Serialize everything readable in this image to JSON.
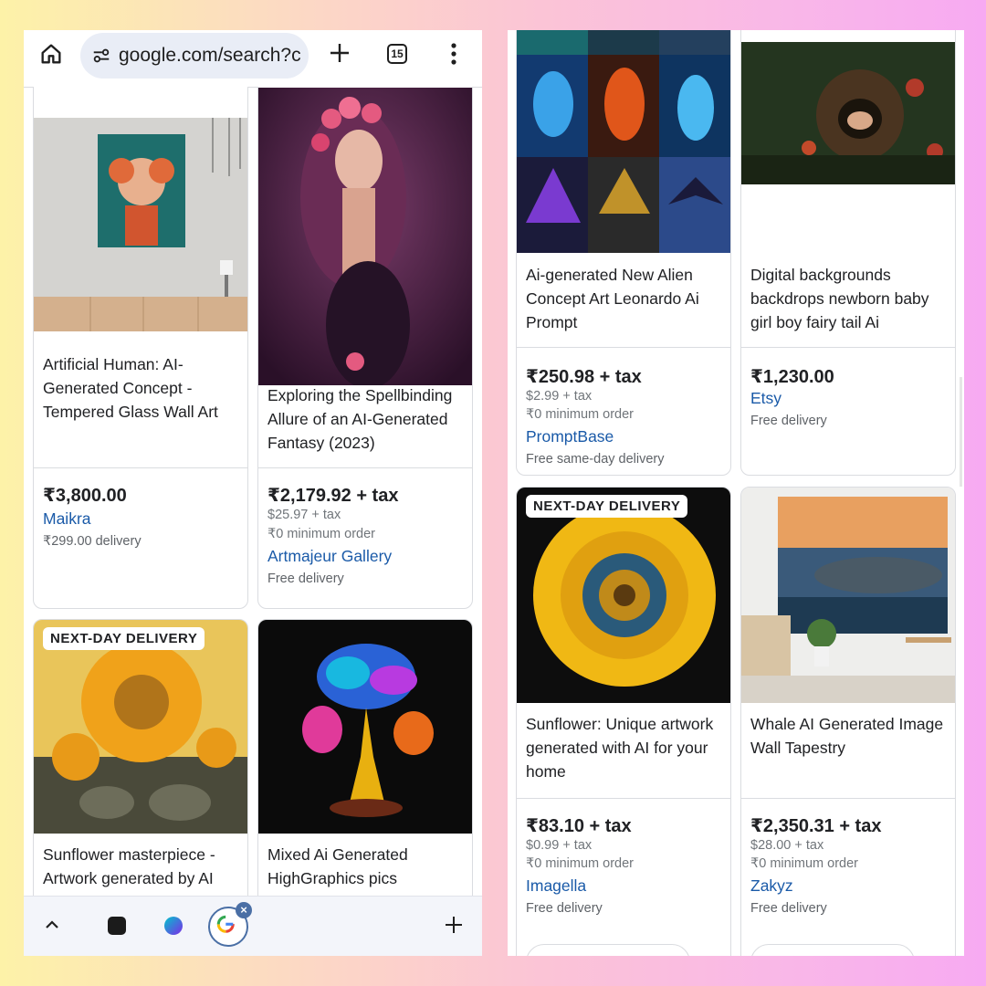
{
  "browser": {
    "url": "google.com/search?c",
    "tab_count": "15"
  },
  "left_panel": {
    "products": [
      {
        "title": "Artificial Human: AI-Generated Concept - Tempered Glass Wall Art",
        "price": "₹3,800.00",
        "merchant": "Maikra",
        "delivery": "₹299.00 delivery"
      },
      {
        "title": "Exploring the Spellbinding Allure of an AI-Generated Fantasy (2023)",
        "price": "₹2,179.92 + tax",
        "tax": "$25.97 + tax",
        "min_order": "₹0 minimum order",
        "merchant": "Artmajeur Gallery",
        "delivery": "Free delivery"
      },
      {
        "badge": "NEXT-DAY DELIVERY",
        "title": "Sunflower masterpiece - Artwork generated by AI"
      },
      {
        "title": "Mixed Ai Generated HighGraphics pics"
      }
    ]
  },
  "right_panel": {
    "products": [
      {
        "title": "Ai-generated New Alien Concept Art Leonardo Ai Prompt",
        "price": "₹250.98 + tax",
        "tax": "$2.99 + tax",
        "min_order": "₹0 minimum order",
        "merchant": "PromptBase",
        "delivery": "Free same-day delivery"
      },
      {
        "title": "Digital backgrounds backdrops newborn baby girl boy fairy tail Ai",
        "price": "₹1,230.00",
        "merchant": "Etsy",
        "delivery": "Free delivery"
      },
      {
        "badge": "NEXT-DAY DELIVERY",
        "title": "Sunflower: Unique artwork generated with AI for your home",
        "price": "₹83.10 + tax",
        "tax": "$0.99 + tax",
        "min_order": "₹0 minimum order",
        "merchant": "Imagella",
        "delivery": "Free delivery"
      },
      {
        "title": "Whale AI Generated Image Wall Tapestry",
        "price": "₹2,350.31 + tax",
        "tax": "$28.00 + tax",
        "min_order": "₹0 minimum order",
        "merchant": "Zakyz",
        "delivery": "Free delivery"
      }
    ]
  },
  "icons": {
    "home": "home-icon",
    "site_settings": "tune-icon",
    "new_tab": "plus-icon",
    "tab_switcher": "tab-count-icon",
    "menu": "more-vert-icon",
    "collapse": "chevron-up-icon"
  },
  "colors": {
    "link": "#1a5aa8",
    "url_bar": "#e9edf6",
    "border": "#dadce0"
  }
}
